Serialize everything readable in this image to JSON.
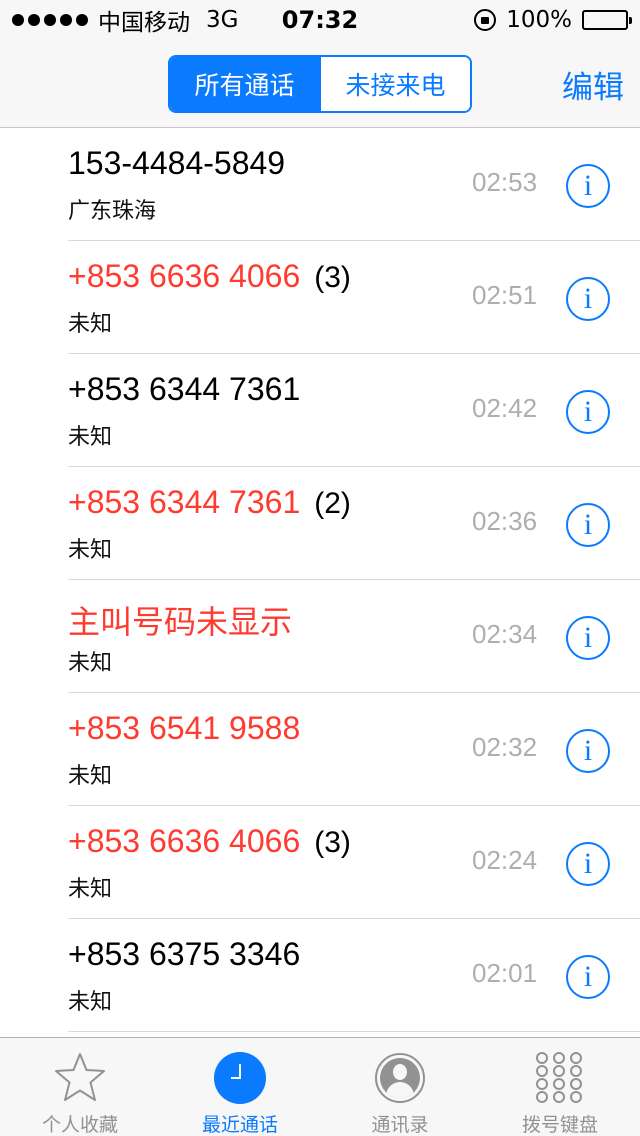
{
  "status_bar": {
    "carrier": "中国移动",
    "network": "3G",
    "time": "07:32",
    "battery": "100%"
  },
  "nav": {
    "segments": [
      "所有通话",
      "未接来电"
    ],
    "selected_segment": "所有通话",
    "edit_label": "编辑"
  },
  "calls": [
    {
      "number": "153-4484-5849",
      "count": "",
      "location": "广东珠海",
      "time": "02:53",
      "missed": false
    },
    {
      "number": "+853 6636 4066",
      "count": "(3)",
      "location": "未知",
      "time": "02:51",
      "missed": true
    },
    {
      "number": "+853 6344 7361",
      "count": "",
      "location": "未知",
      "time": "02:42",
      "missed": false
    },
    {
      "number": "+853 6344 7361",
      "count": "(2)",
      "location": "未知",
      "time": "02:36",
      "missed": true
    },
    {
      "number": "主叫号码未显示",
      "count": "",
      "location": "未知",
      "time": "02:34",
      "missed": true
    },
    {
      "number": "+853 6541 9588",
      "count": "",
      "location": "未知",
      "time": "02:32",
      "missed": true
    },
    {
      "number": "+853 6636 4066",
      "count": "(3)",
      "location": "未知",
      "time": "02:24",
      "missed": true
    },
    {
      "number": "+853 6375 3346",
      "count": "",
      "location": "未知",
      "time": "02:01",
      "missed": false
    }
  ],
  "info_glyph": "i",
  "tabbar": {
    "tabs": [
      {
        "label": "个人收藏",
        "icon": "star-icon"
      },
      {
        "label": "最近通话",
        "icon": "clock-icon"
      },
      {
        "label": "通讯录",
        "icon": "contacts-icon"
      },
      {
        "label": "拨号键盘",
        "icon": "keypad-icon"
      }
    ],
    "active": "最近通话"
  },
  "colors": {
    "accent": "#0a7aff",
    "missed": "#ff3b30",
    "muted": "#aeaeb2"
  }
}
